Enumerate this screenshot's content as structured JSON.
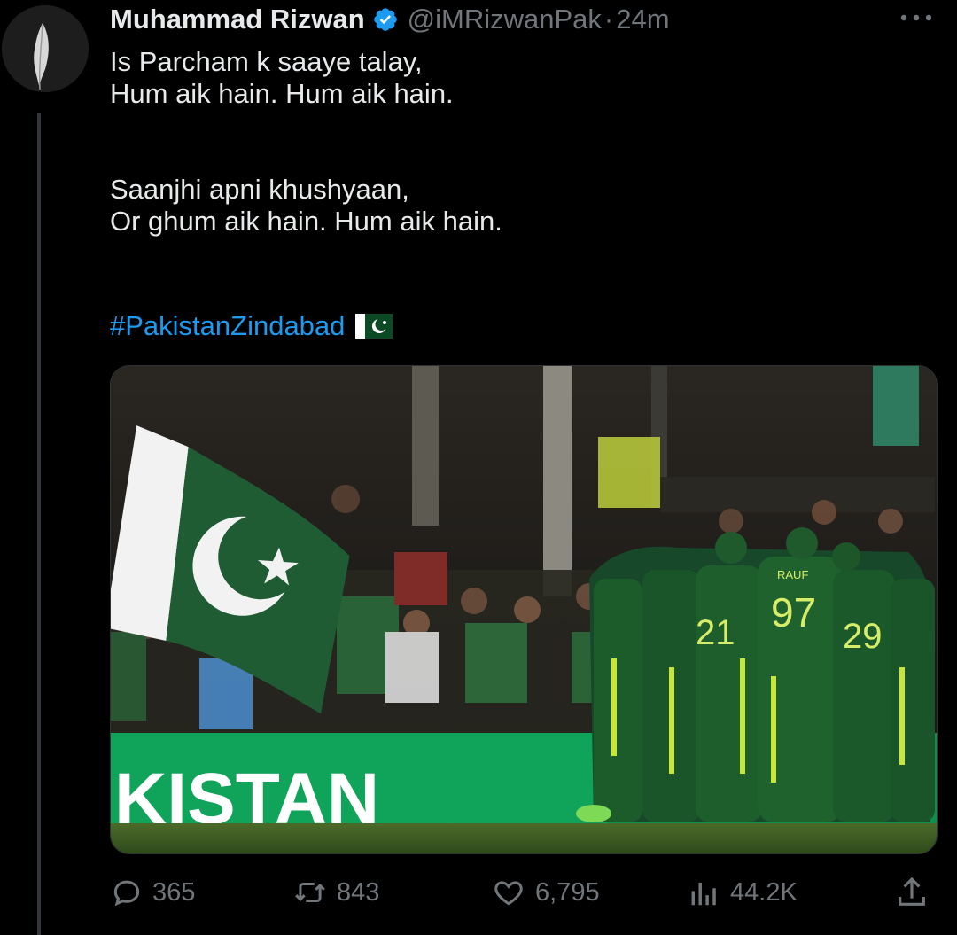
{
  "tweet": {
    "author_name": "Muhammad Rizwan",
    "handle": "@iMRizwanPak",
    "separator": "·",
    "time": "24m",
    "text_lines": [
      "Is Parcham k saaye talay,",
      "Hum aik hain. Hum aik hain.",
      "Saanjhi apni khushyaan,",
      "Or ghum aik hain. Hum aik hain."
    ],
    "hashtag": "#PakistanZindabad",
    "banner_text": "KISTAN",
    "jersey_numbers": [
      "97",
      "21",
      "29"
    ],
    "jersey_name": "RAUF"
  },
  "actions": {
    "replies": "365",
    "retweets": "843",
    "likes": "6,795",
    "views": "44.2K"
  },
  "icons": {
    "verified": "verified-badge-icon",
    "more": "more-horizontal-icon",
    "reply": "reply-bubble-icon",
    "retweet": "retweet-icon",
    "like": "heart-icon",
    "views": "bar-chart-icon",
    "share": "share-upload-icon",
    "flag": "pakistan-flag-emoji"
  },
  "colors": {
    "background": "#000000",
    "text": "#e7e9ea",
    "muted": "#71767b",
    "link": "#1d9bf0",
    "verified": "#1d9bf0",
    "kit_green": "#1c5b2a",
    "kit_yellow": "#c8e63a"
  }
}
